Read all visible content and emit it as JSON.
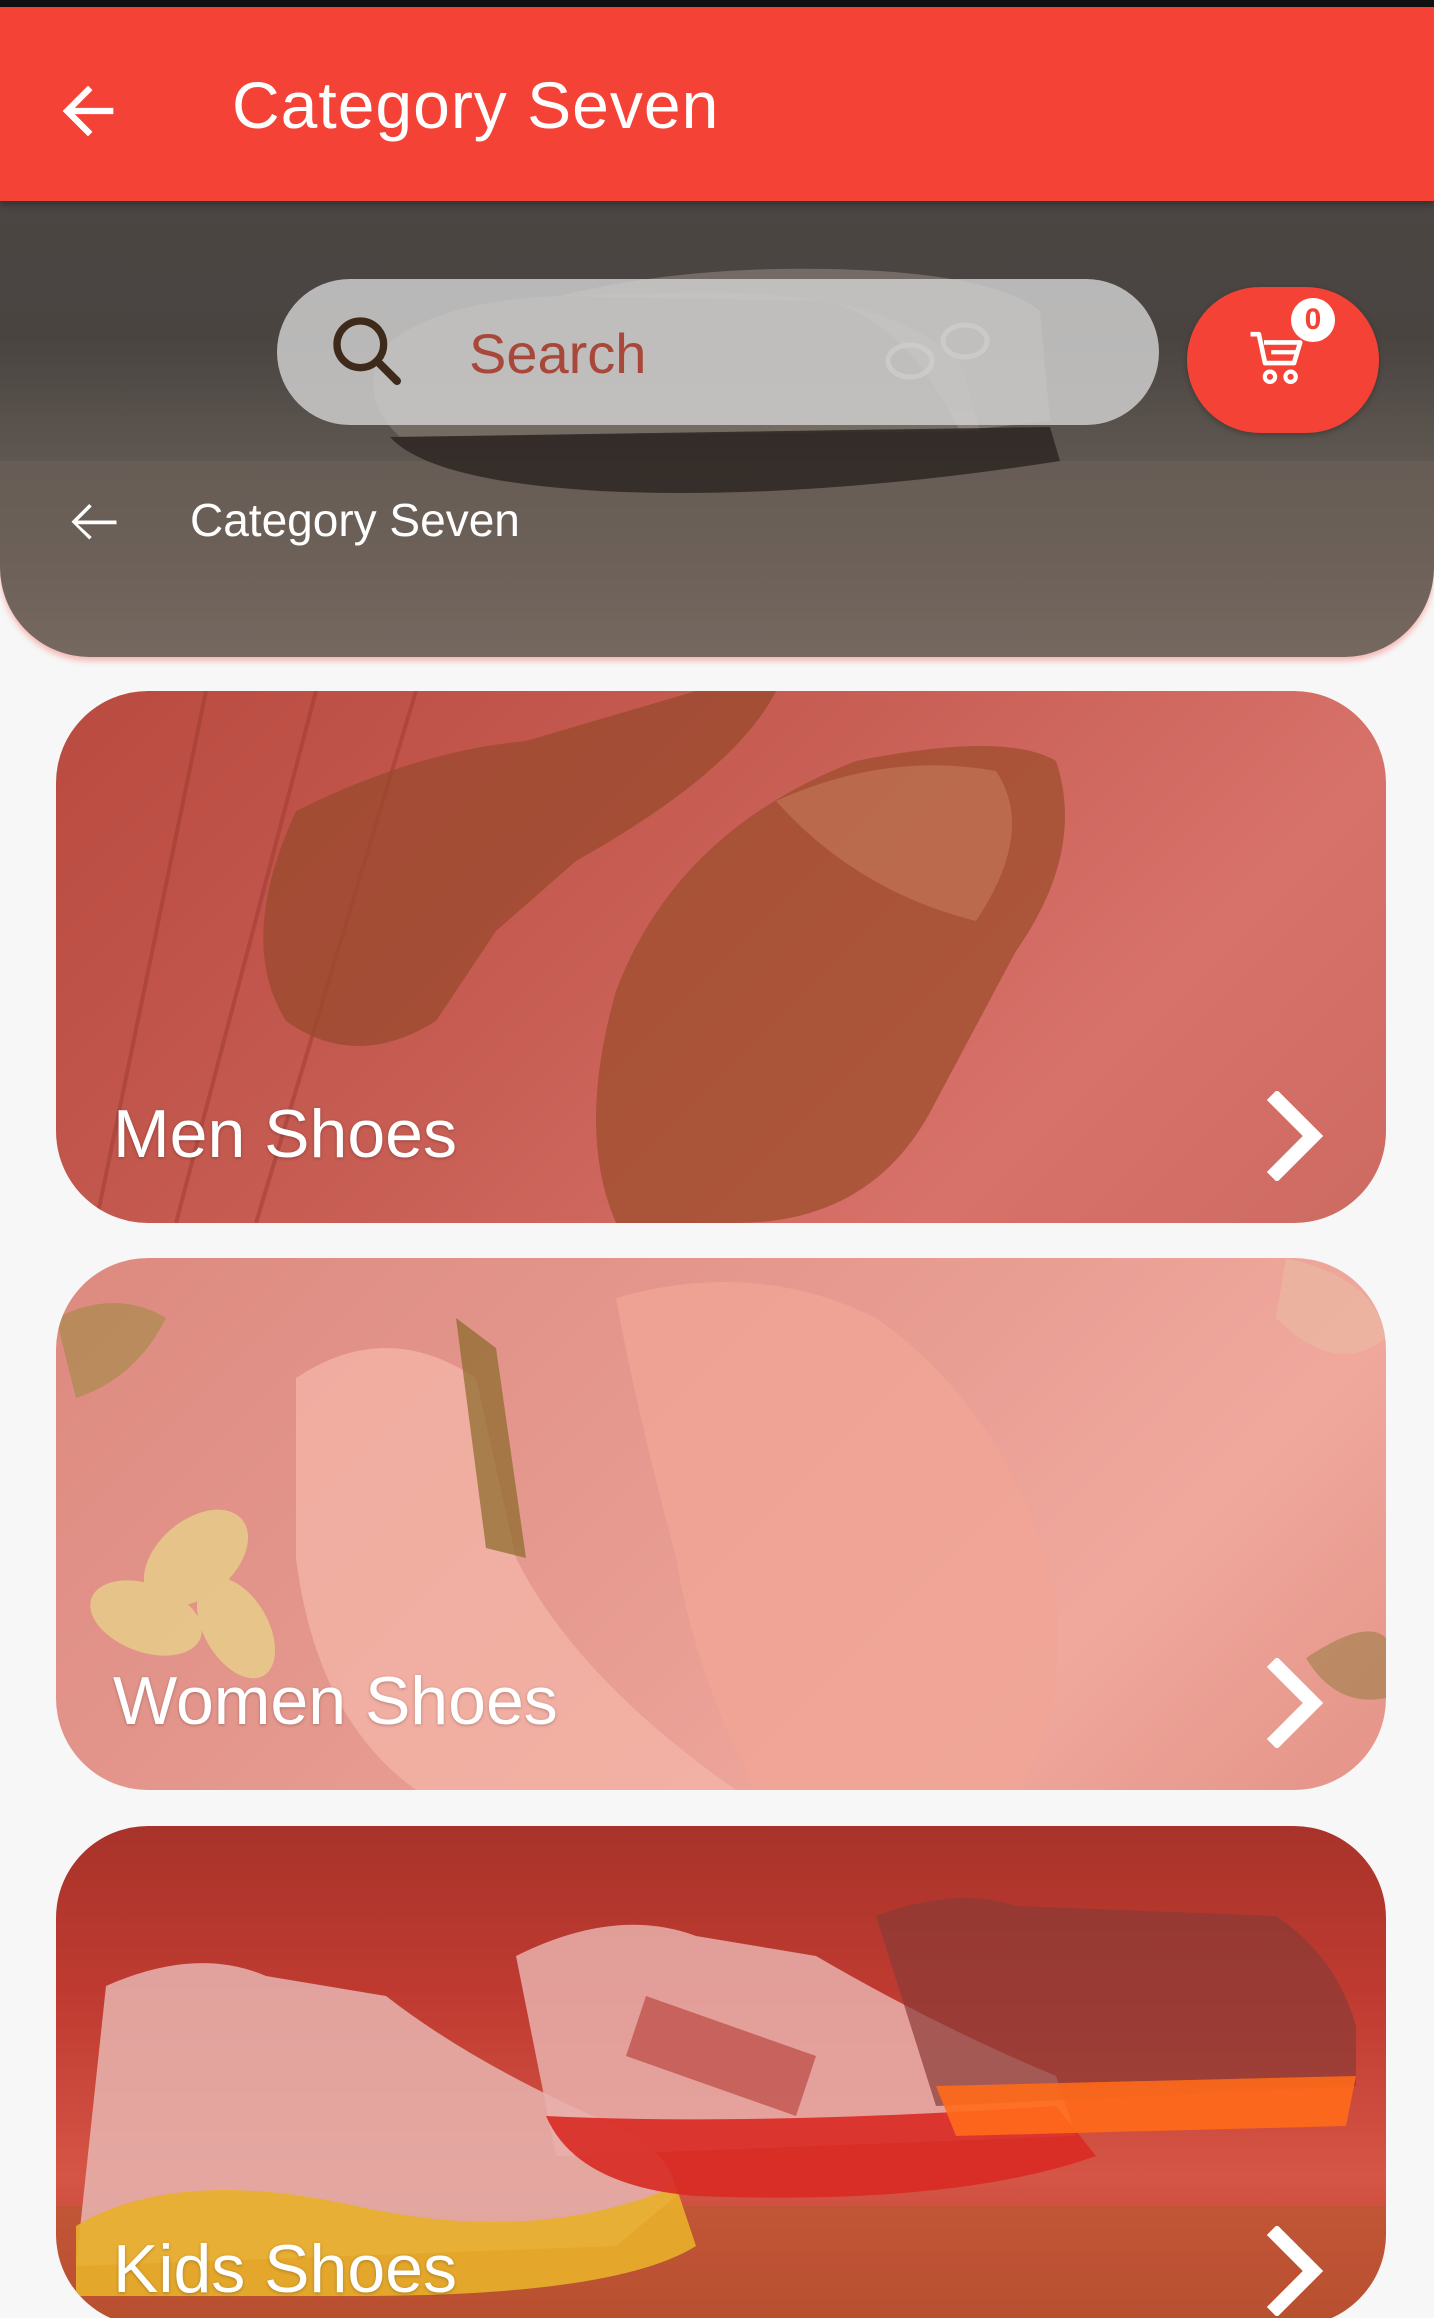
{
  "appbar": {
    "title": "Category Seven"
  },
  "hero": {
    "breadcrumb": "Category Seven"
  },
  "search": {
    "placeholder": "Search"
  },
  "cart": {
    "count": "0"
  },
  "categories": [
    {
      "label": "Men Shoes"
    },
    {
      "label": "Women Shoes"
    },
    {
      "label": "Kids Shoes"
    }
  ],
  "colors": {
    "primary": "#f44336",
    "on_primary": "#ffffff",
    "search_bg": "#d2d2d2",
    "page_bg": "#f7f7f7"
  }
}
